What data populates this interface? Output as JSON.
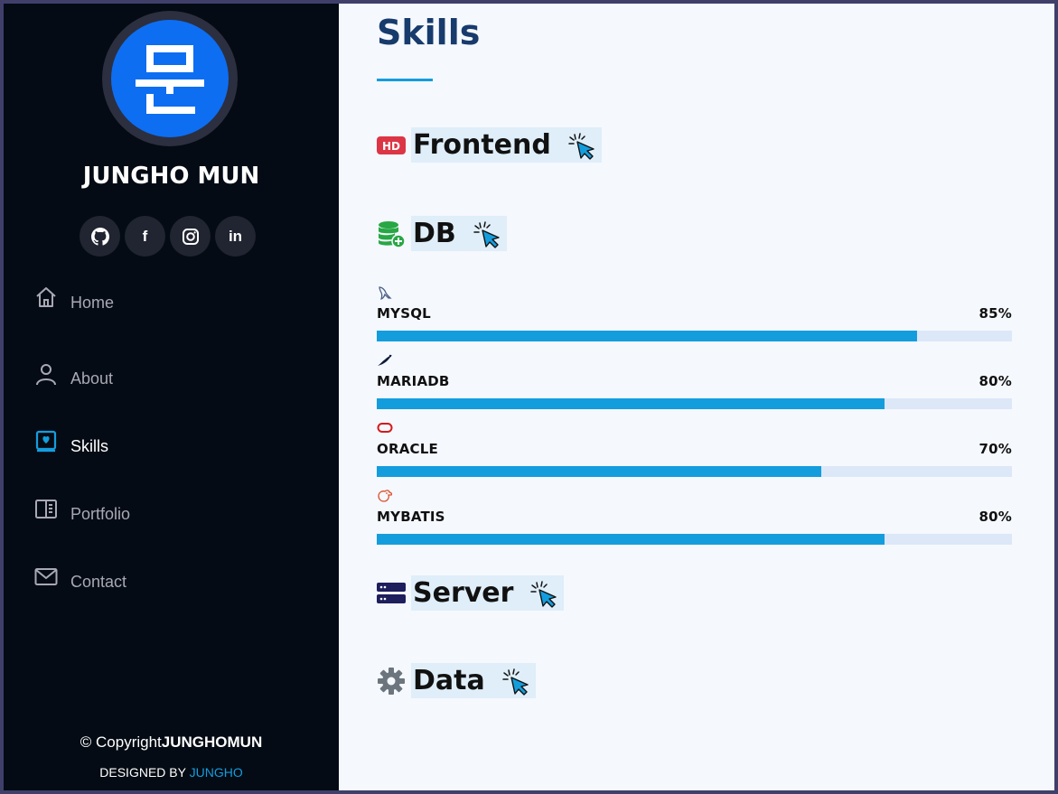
{
  "profile": {
    "avatar_glyph": "문",
    "name": "JUNGHO MUN"
  },
  "social": [
    {
      "icon": "github-icon"
    },
    {
      "icon": "facebook-icon",
      "text": "f"
    },
    {
      "icon": "instagram-icon"
    },
    {
      "icon": "linkedin-icon",
      "text": "in"
    }
  ],
  "nav": [
    {
      "label": "Home",
      "icon": "home-icon"
    },
    {
      "label": "About",
      "icon": "person-icon"
    },
    {
      "label": "Skills",
      "icon": "skills-book-icon",
      "active": true
    },
    {
      "label": "Portfolio",
      "icon": "portfolio-icon"
    },
    {
      "label": "Contact",
      "icon": "envelope-icon"
    }
  ],
  "footer": {
    "copyright_prefix": "© Copyright",
    "copyright_name": "JUNGHOMUN",
    "designed_prefix": "DESIGNED BY ",
    "designed_name": "JUNGHO"
  },
  "section": {
    "title": "Skills"
  },
  "categories": [
    {
      "name": "Frontend",
      "icon": "hd-icon"
    },
    {
      "name": "DB",
      "icon": "database-icon"
    },
    {
      "name": "Server",
      "icon": "server-icon"
    },
    {
      "name": "Data",
      "icon": "gear-icon"
    }
  ],
  "db_skills": [
    {
      "name": "MYSQL",
      "percent_text": "85%",
      "value": 85,
      "icon": "mysql-dolphin-icon"
    },
    {
      "name": "MARIADB",
      "percent_text": "80%",
      "value": 80,
      "icon": "mariadb-seal-icon"
    },
    {
      "name": "ORACLE",
      "percent_text": "70%",
      "value": 70,
      "icon": "oracle-icon"
    },
    {
      "name": "MYBATIS",
      "percent_text": "80%",
      "value": 80,
      "icon": "mybatis-bird-icon"
    }
  ],
  "colors": {
    "sidebar_bg": "#040b14",
    "accent": "#149ddd",
    "avatar_bg": "#0d6ef2",
    "title": "#173b6c",
    "bar_track": "#dce8f8"
  }
}
